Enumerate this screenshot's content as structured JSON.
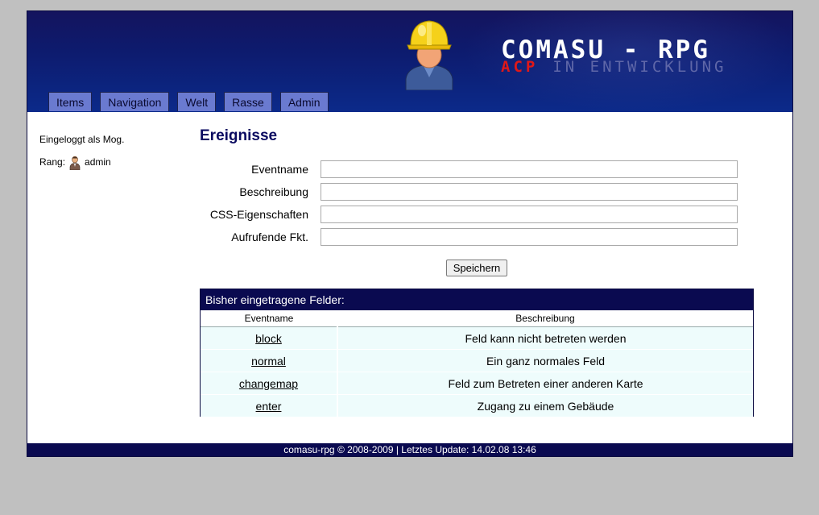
{
  "header": {
    "title": "COMASU - RPG",
    "subtitle_accent": "ACP",
    "subtitle_rest": "IN ENTWICKLUNG"
  },
  "tabs": [
    {
      "label": "Items"
    },
    {
      "label": "Navigation"
    },
    {
      "label": "Welt"
    },
    {
      "label": "Rasse"
    },
    {
      "label": "Admin"
    }
  ],
  "sidebar": {
    "logged_in": "Eingeloggt als Mog.",
    "rank_label": "Rang:",
    "rank_value": "admin",
    "rank_icon": "admin-user-icon"
  },
  "main": {
    "title": "Ereignisse",
    "form": {
      "fields": [
        {
          "label": "Eventname",
          "value": ""
        },
        {
          "label": "Beschreibung",
          "value": ""
        },
        {
          "label": "CSS-Eigenschaften",
          "value": ""
        },
        {
          "label": "Aufrufende Fkt.",
          "value": ""
        }
      ],
      "submit_label": "Speichern"
    },
    "table": {
      "title": "Bisher eingetragene Felder:",
      "columns": [
        "Eventname",
        "Beschreibung"
      ],
      "rows": [
        {
          "name": "block",
          "description": "Feld kann nicht betreten werden"
        },
        {
          "name": "normal",
          "description": "Ein ganz normales Feld"
        },
        {
          "name": "changemap",
          "description": "Feld zum Betreten einer anderen Karte"
        },
        {
          "name": "enter",
          "description": "Zugang zu einem Gebäude"
        }
      ]
    }
  },
  "footer": {
    "text": "comasu-rpg © 2008-2009 | Letztes Update: 14.02.08 13:46"
  },
  "colors": {
    "header_bg": "#0c1c72",
    "tab_bg": "#6a7ad0",
    "table_header_bg": "#0a0a50",
    "row_bg": "#eefcfc",
    "accent_red": "#e01818"
  }
}
